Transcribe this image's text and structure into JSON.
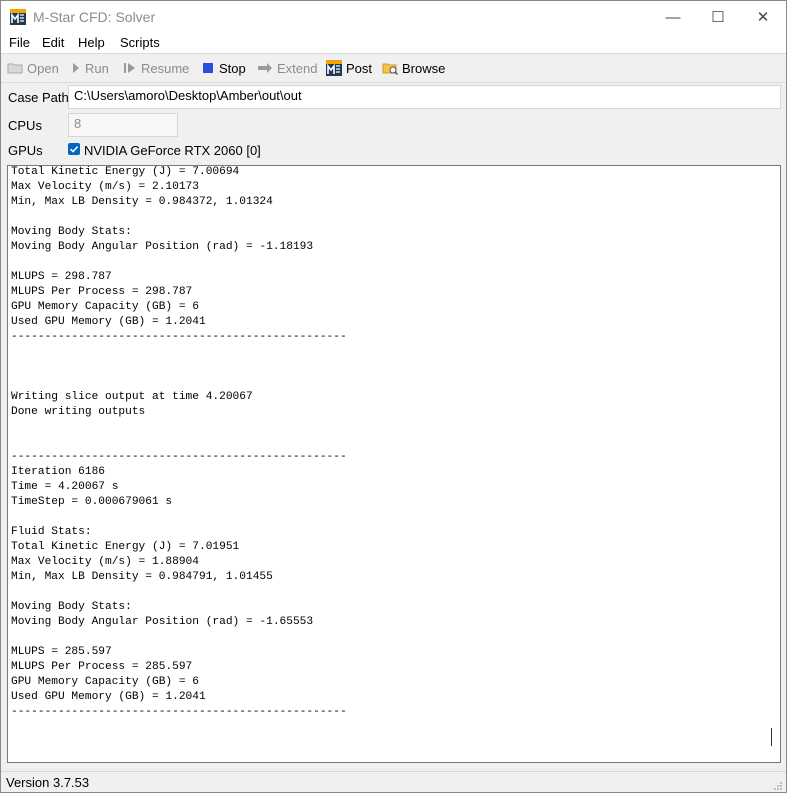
{
  "window": {
    "title": "M-Star CFD: Solver"
  },
  "title_buttons": {
    "minimize": "—",
    "maximize": "☐",
    "close": "✕"
  },
  "menu": [
    "File",
    "Edit",
    "Help",
    "Scripts"
  ],
  "toolbar": {
    "open": "Open",
    "run": "Run",
    "resume": "Resume",
    "stop": "Stop",
    "extend": "Extend",
    "post": "Post",
    "browse": "Browse"
  },
  "case_path": {
    "label": "Case Path",
    "value": "C:\\Users\\amoro\\Desktop\\Amber\\out\\out"
  },
  "cpus": {
    "label": "CPUs",
    "value": "8"
  },
  "gpus": {
    "label": "GPUs",
    "device": "NVIDIA GeForce RTX 2060 [0]",
    "checked": true
  },
  "console_text": "Total Kinetic Energy (J) = 7.00694\nMax Velocity (m/s) = 2.10173\nMin, Max LB Density = 0.984372, 1.01324\n\nMoving Body Stats:\nMoving Body Angular Position (rad) = -1.18193\n\nMLUPS = 298.787\nMLUPS Per Process = 298.787\nGPU Memory Capacity (GB) = 6\nUsed GPU Memory (GB) = 1.2041\n--------------------------------------------------\n\n\n\nWriting slice output at time 4.20067\nDone writing outputs\n\n\n--------------------------------------------------\nIteration 6186\nTime = 4.20067 s\nTimeStep = 0.000679061 s\n\nFluid Stats:\nTotal Kinetic Energy (J) = 7.01951\nMax Velocity (m/s) = 1.88904\nMin, Max LB Density = 0.984791, 1.01455\n\nMoving Body Stats:\nMoving Body Angular Position (rad) = -1.65553\n\nMLUPS = 285.597\nMLUPS Per Process = 285.597\nGPU Memory Capacity (GB) = 6\nUsed GPU Memory (GB) = 1.2041\n--------------------------------------------------",
  "status": {
    "version": "Version 3.7.53"
  },
  "colors": {
    "accent": "#0067c0",
    "stop_icon": "#2b4fd8",
    "disabled_text": "#8c8c8c"
  }
}
